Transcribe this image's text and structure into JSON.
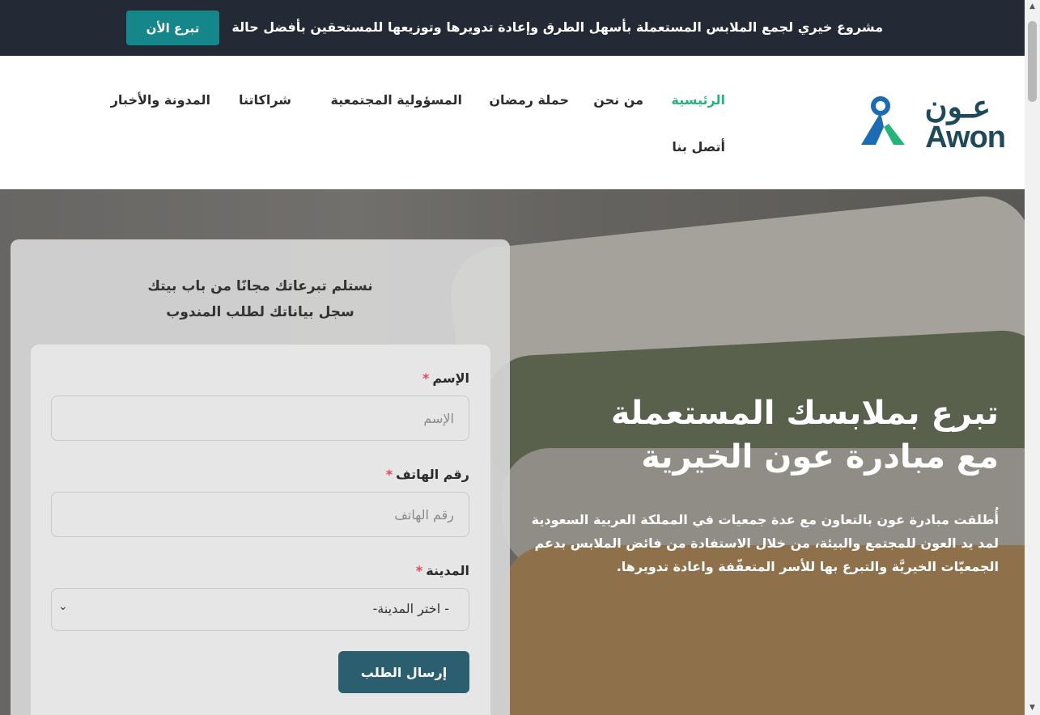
{
  "topbar": {
    "tagline": "مشروع خيري لجمع الملابس المستعملة بأسهل الطرق وإعادة تدويرها وتوزيعها للمستحقين بأفضل حالة",
    "donate_label": "تبرع الأن"
  },
  "logo": {
    "arabic": "عـون",
    "latin": "Awon"
  },
  "nav": {
    "items": [
      {
        "label": "الرئيسية",
        "active": true
      },
      {
        "label": "من نحن"
      },
      {
        "label": "حملة رمضان"
      },
      {
        "label": "المسؤولية المجتمعية"
      },
      {
        "label": "شراكاتنا"
      },
      {
        "label": "المدونة والأخبار"
      },
      {
        "label": "أتصل بنا"
      }
    ]
  },
  "hero": {
    "title_line1": "تبرع بملابسك المستعملة",
    "title_line2": "مع مبادرة عون الخيرية",
    "description": "أُطلقت مبادرة عون بالتعاون مع عدة جمعيات في المملكة العربية السعودية لمد يد العون للمجتمع والبيئة، من خلال الاستفادة من فائض الملابس بدعم الجمعيّات الخيريَّة والتبرع بها للأسر المتعفّفة واعادة تدويرها."
  },
  "form": {
    "heading_line1": "نستلم تبرعاتك مجانًا من باب بيتك",
    "heading_line2": "سجل بياناتك لطلب المندوب",
    "name_label": "الإسم",
    "name_placeholder": "الإسم",
    "phone_label": "رقم الهاتف",
    "phone_placeholder": "رقم الهاتف",
    "city_label": "المدينة",
    "city_selected": "- اختر المدينة-",
    "required_mark": "*",
    "submit_label": "إرسال الطلب"
  },
  "colors": {
    "topbar_bg": "#242a35",
    "accent": "#15878a",
    "nav_active": "#22b57a",
    "submit": "#2b5e6e",
    "required": "#e0495b"
  },
  "icons": [
    "hanger-logo-icon",
    "chevron-down-icon",
    "scroll-up-icon",
    "scroll-down-icon"
  ]
}
